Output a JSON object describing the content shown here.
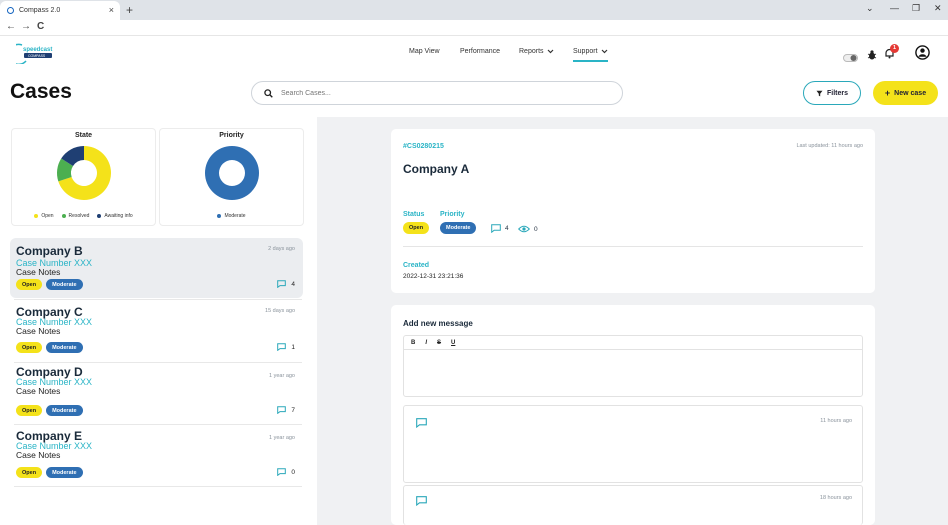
{
  "browser": {
    "tab_title": "Compass 2.0",
    "tab_close": "×",
    "new_tab": "+",
    "nav": {
      "back": "←",
      "forward": "→",
      "reload": "C"
    },
    "window": {
      "chevron": "⌄",
      "minimize": "—",
      "restore": "❐",
      "close": "✕"
    }
  },
  "header": {
    "logo_text_top": "speedcast",
    "logo_text_bottom": "COMPASS",
    "menu": [
      {
        "label": "Map View",
        "dropdown": false,
        "active": false
      },
      {
        "label": "Performance",
        "dropdown": false,
        "active": false
      },
      {
        "label": "Reports",
        "dropdown": true,
        "active": false
      },
      {
        "label": "Support",
        "dropdown": true,
        "active": true
      }
    ],
    "notification_count": "1"
  },
  "page": {
    "title": "Cases",
    "search_placeholder": "Search Cases...",
    "filters_label": "Filters",
    "new_case_label": "New case"
  },
  "charts": {
    "state": {
      "title": "State",
      "legend": [
        {
          "label": "Open",
          "color": "#f4e21a"
        },
        {
          "label": "Resolved",
          "color": "#4caf50"
        },
        {
          "label": "Awaiting info",
          "color": "#1f3f73"
        }
      ]
    },
    "priority": {
      "title": "Priority",
      "legend": [
        {
          "label": "Moderate",
          "color": "#2f6fb3"
        }
      ]
    }
  },
  "chart_data": [
    {
      "type": "pie",
      "title": "State",
      "categories": [
        "Open",
        "Resolved",
        "Awaiting info"
      ],
      "values": [
        70,
        14,
        16
      ]
    },
    {
      "type": "pie",
      "title": "Priority",
      "categories": [
        "Moderate"
      ],
      "values": [
        100
      ]
    }
  ],
  "cases": [
    {
      "company": "Company B",
      "number": "Case Number XXX",
      "notes": "Case Notes",
      "time": "2 days ago",
      "status": "Open",
      "priority": "Moderate",
      "comments": "4",
      "selected": true
    },
    {
      "company": "Company C",
      "number": "Case Number XXX",
      "notes": "Case Notes",
      "time": "15 days ago",
      "status": "Open",
      "priority": "Moderate",
      "comments": "1",
      "selected": false
    },
    {
      "company": "Company D",
      "number": "Case Number XXX",
      "notes": "Case Notes",
      "time": "1 year ago",
      "status": "Open",
      "priority": "Moderate",
      "comments": "7",
      "selected": false
    },
    {
      "company": "Company E",
      "number": "Case Number XXX",
      "notes": "Case Notes",
      "time": "1 year ago",
      "status": "Open",
      "priority": "Moderate",
      "comments": "0",
      "selected": false
    }
  ],
  "detail": {
    "case_id": "#CS0280215",
    "last_updated": "Last updated: 11 hours ago",
    "company": "Company A",
    "status_label": "Status",
    "priority_label": "Priority",
    "status": "Open",
    "priority": "Moderate",
    "comments": "4",
    "watchers": "0",
    "created_label": "Created",
    "created_value": "2022-12-31 23:21:36"
  },
  "messages": {
    "title": "Add new message",
    "toolbar": [
      "B",
      "I",
      "S",
      "U"
    ],
    "items": [
      {
        "time": "11 hours ago"
      },
      {
        "time": "18 hours ago"
      }
    ]
  },
  "colors": {
    "accent": "#2ab4c6",
    "yellow": "#f4e21a",
    "moderate": "#2f6fb3",
    "resolved": "#4caf50",
    "awaiting": "#1f3f73"
  }
}
